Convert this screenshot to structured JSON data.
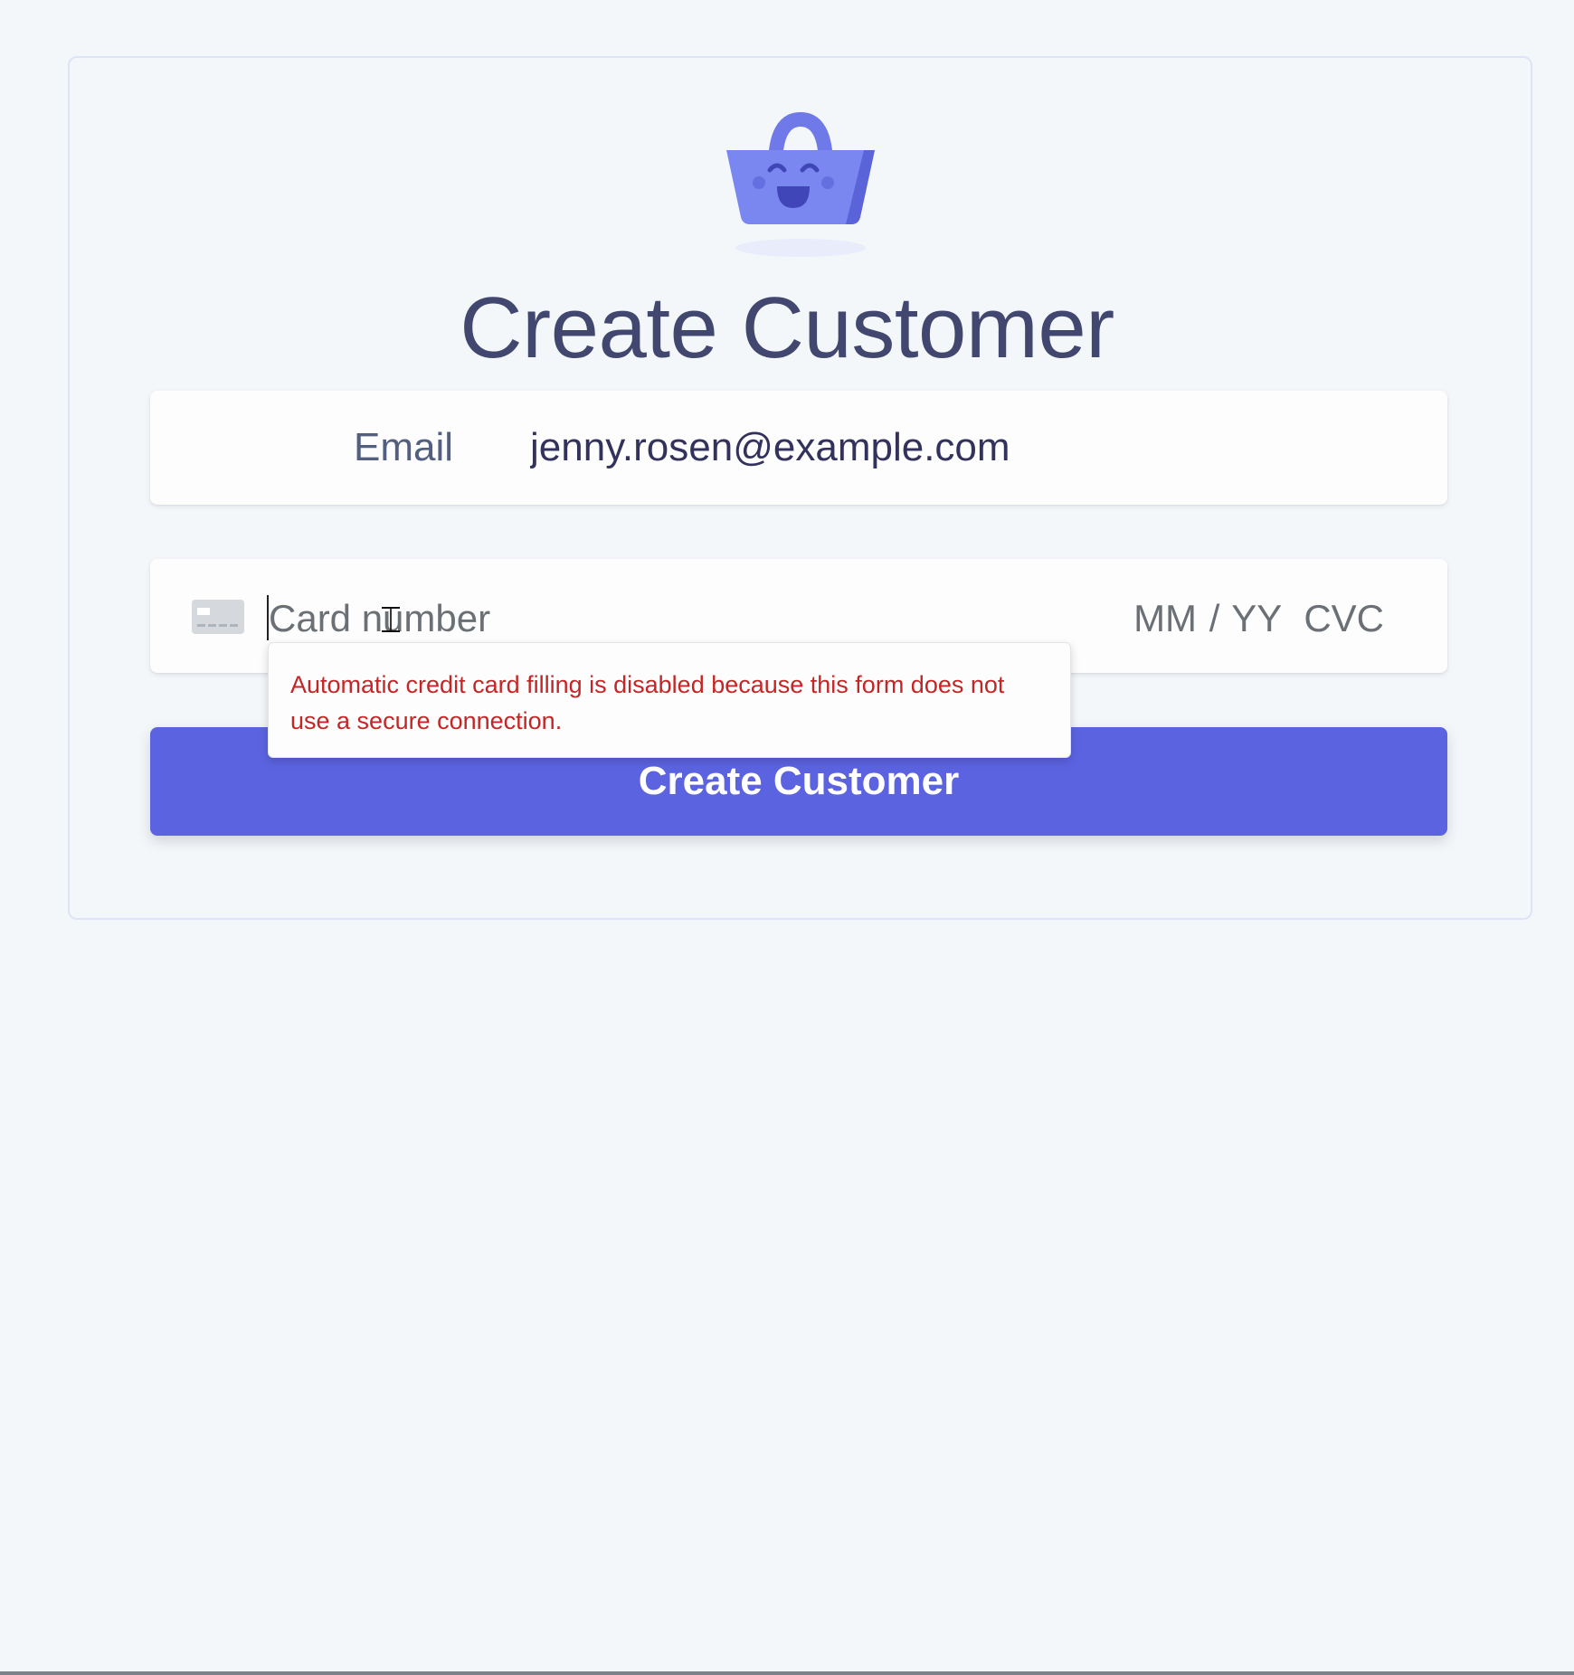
{
  "page": {
    "title": "Create Customer",
    "logo_icon": "smiling-shopping-basket-icon",
    "accent_color": "#5b63e0"
  },
  "form": {
    "email": {
      "label": "Email",
      "value": "jenny.rosen@example.com"
    },
    "card": {
      "icon": "credit-card-icon",
      "number_placeholder": "Card number",
      "expiry_placeholder": "MM / YY",
      "cvc_placeholder": "CVC"
    },
    "submit_label": "Create Customer"
  },
  "autofill_warning": {
    "text": "Automatic credit card filling is disabled because this form does not use a secure connection.",
    "color": "#c32626"
  }
}
